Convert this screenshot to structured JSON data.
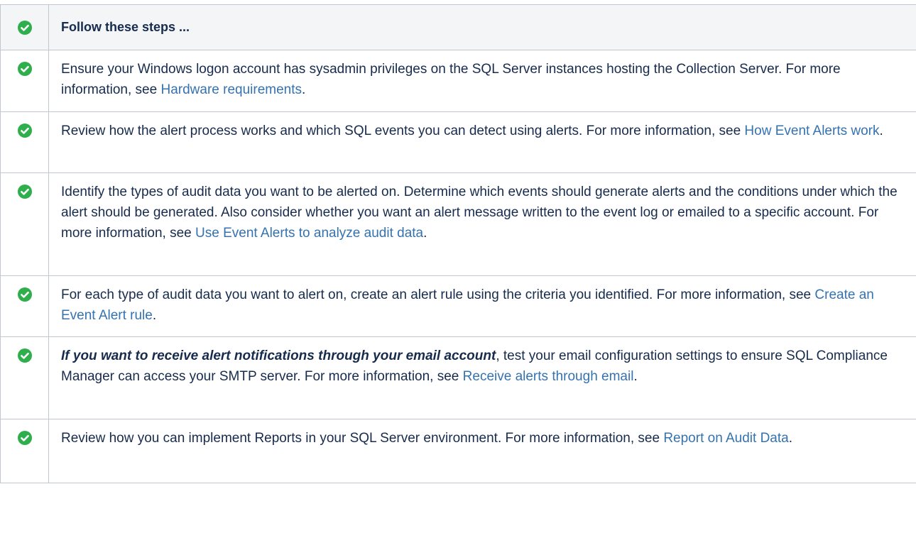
{
  "colors": {
    "check": "#2eaf4c",
    "link": "#3572b0",
    "text": "#172b4d",
    "header_bg": "#f4f5f7",
    "border": "#c1c7d0"
  },
  "header": {
    "icon": "check-circle-icon",
    "title": "Follow these steps ..."
  },
  "steps": [
    {
      "icon": "check-circle-icon",
      "pre": "Ensure your Windows logon account has sysadmin privileges on the SQL Server instances hosting the Collection Server. For more information, see ",
      "link": "Hardware requirements",
      "post": "."
    },
    {
      "icon": "check-circle-icon",
      "pre": "Review how the alert process works and which SQL events you can detect using alerts. For more information, see ",
      "link": "How Event Alerts work",
      "post": "."
    },
    {
      "icon": "check-circle-icon",
      "pre": "Identify the types of audit data you want to be alerted on. Determine which events should generate alerts and the conditions under which the alert should be generated. Also consider whether you want an alert message written to the event log or emailed to a specific account. For more information, see ",
      "link": "Use Event Alerts to analyze audit data",
      "post": "."
    },
    {
      "icon": "check-circle-icon",
      "pre": "For each type of audit data you want to alert on, create an alert rule using the criteria you identified. For more information, see ",
      "link": "Create an Event Alert rule",
      "post": "."
    },
    {
      "icon": "check-circle-icon",
      "emphasis": "If you want to receive alert notifications through your email account",
      "pre": ", test your email configuration settings to ensure SQL Compliance Manager can access your SMTP server. For more information, see ",
      "link": "Receive alerts through email",
      "post": "."
    },
    {
      "icon": "check-circle-icon",
      "pre": "Review how you can implement Reports in your SQL Server environment. For more information, see ",
      "link": "Report on Audit Data",
      "post": "."
    }
  ]
}
